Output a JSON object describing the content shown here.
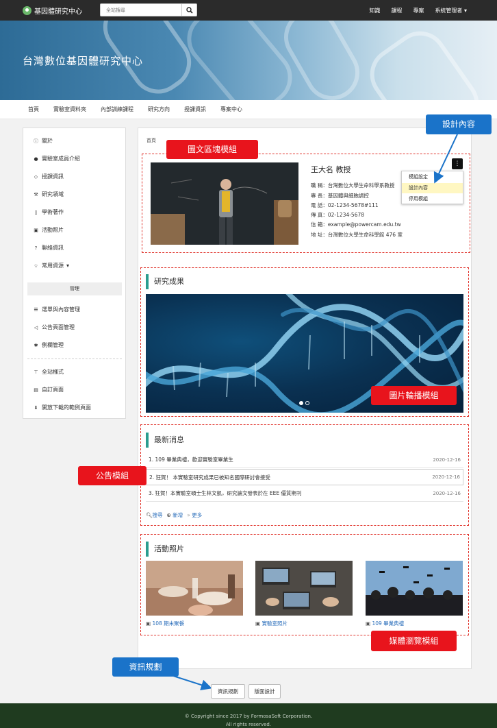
{
  "topbar": {
    "brand": "基因體研究中心",
    "search_placeholder": "全站搜尋",
    "nav": [
      "知識",
      "課程",
      "專案",
      "系統管理者"
    ]
  },
  "banner": {
    "title": "台灣數位基因體研究中心"
  },
  "subnav": [
    "首頁",
    "實驗室資料夾",
    "內部訓練課程",
    "研究方向",
    "授課資訊",
    "專案中心"
  ],
  "sidebar": {
    "items": [
      {
        "icon": "info-icon",
        "label": "關於"
      },
      {
        "icon": "user-icon",
        "label": "實驗室成員介紹"
      },
      {
        "icon": "tag-icon",
        "label": "授課資訊"
      },
      {
        "icon": "wrench-icon",
        "label": "研究領域"
      },
      {
        "icon": "file-icon",
        "label": "學術著作"
      },
      {
        "icon": "image-icon",
        "label": "活動照片"
      },
      {
        "icon": "question-icon",
        "label": "聯絡資訊"
      },
      {
        "icon": "star-icon",
        "label": "常用資源"
      }
    ],
    "admin_heading": "管理",
    "admin_items": [
      {
        "icon": "list-icon",
        "label": "選單與內容管理"
      },
      {
        "icon": "megaphone-icon",
        "label": "公告頁面管理"
      },
      {
        "icon": "gear-icon",
        "label": "側欄管理"
      }
    ],
    "extra_items": [
      {
        "icon": "brush-icon",
        "label": "全站樣式"
      },
      {
        "icon": "page-icon",
        "label": "自訂頁面"
      },
      {
        "icon": "download-icon",
        "label": "開放下載的範例頁面"
      }
    ]
  },
  "main": {
    "breadcrumb": "首頁",
    "teacher": {
      "name": "王大名 教授",
      "lines": [
        "職 稱：台灣數位大學生命科學系教授",
        "專 長：基因體與細胞調控",
        "電 話：02-1234-5678#111",
        "傳 真：02-1234-5678",
        "信 箱：example@powercam.edu.tw",
        "地 址：台灣數位大學生命科學館 476 室"
      ]
    },
    "context_menu": [
      "模組設定",
      "設計內容",
      "停用模組"
    ],
    "research_title": "研究成果",
    "news_title": "最新消息",
    "news": [
      {
        "text": "1. 109 畢業典禮，歡迎實驗室畢業生",
        "date": "2020-12-16"
      },
      {
        "text": "2. 狂賀！ 本實驗室研究成果已被知名國際研討會接受",
        "date": "2020-12-16"
      },
      {
        "text": "3. 狂賀！本實驗室碩士生林文凱，研究論文發表於在 EEE 優質期刊",
        "date": "2020-12-16"
      }
    ],
    "news_actions": {
      "search": "搜尋",
      "add": "新增",
      "more": "更多"
    },
    "photos_title": "活動照片",
    "photos": [
      {
        "caption": "108 期末聚餐"
      },
      {
        "caption": "實驗室照片"
      },
      {
        "caption": "109 畢業典禮"
      }
    ]
  },
  "annotations": {
    "design_content": "設計內容",
    "text_block_module": "圖文區塊模組",
    "carousel_module": "圖片輪播模組",
    "announcement_module": "公告模組",
    "media_module": "媒體瀏覽模組",
    "info_planning": "資訊規劃"
  },
  "bottom_buttons": [
    "資訊規劃",
    "版面設計"
  ],
  "footer": {
    "line1": "© Copyright since 2017 by FormosaSoft Corporation.",
    "line2": "All rights reserved."
  }
}
